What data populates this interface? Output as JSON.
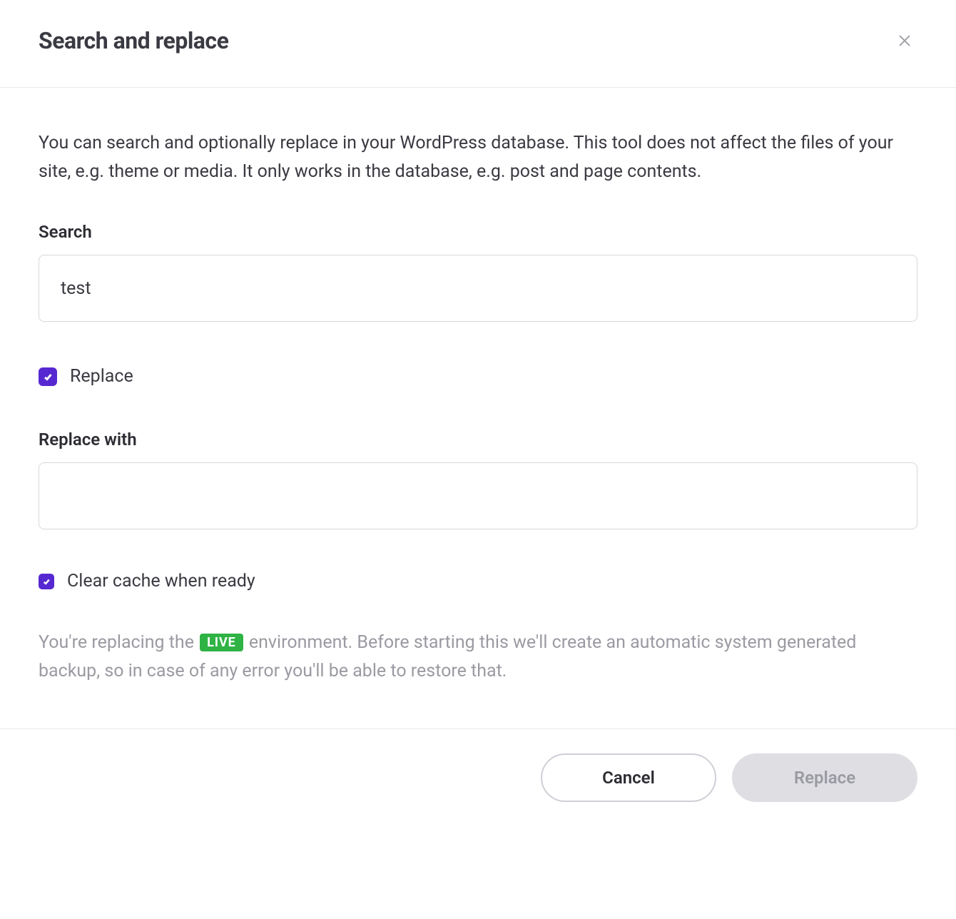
{
  "header": {
    "title": "Search and replace"
  },
  "body": {
    "description": "You can search and optionally replace in your WordPress database. This tool does not affect the files of your site, e.g. theme or media. It only works in the database, e.g. post and page contents.",
    "search_label": "Search",
    "search_value": "test",
    "replace_checkbox_label": "Replace",
    "replace_with_label": "Replace with",
    "replace_with_value": "",
    "clear_cache_label": "Clear cache when ready",
    "warning_pre": "You're replacing the ",
    "live_badge": "LIVE",
    "warning_post": " environment. Before starting this we'll create an automatic system generated backup, so in case of any error you'll be able to restore that."
  },
  "footer": {
    "cancel_label": "Cancel",
    "replace_label": "Replace"
  },
  "state": {
    "replace_checked": true,
    "clear_cache_checked": true
  },
  "icons": {
    "close": "close-icon",
    "check": "check-icon"
  }
}
